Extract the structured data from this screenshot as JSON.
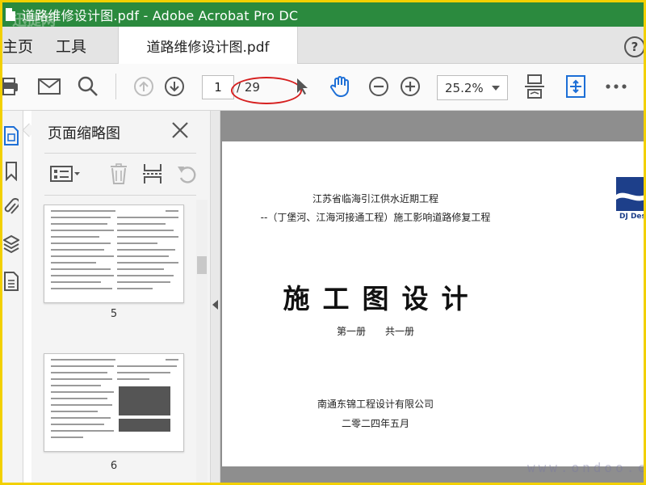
{
  "window": {
    "title": "道路维修设计图.pdf - Adobe Acrobat Pro DC",
    "watermark_top": "迅捷网"
  },
  "tabs": {
    "home": "主页",
    "tools": "工具",
    "document": "道路维修设计图.pdf",
    "help": "?"
  },
  "toolbar": {
    "current_page": "1",
    "total_pages": "/ 29",
    "zoom": "25.2%"
  },
  "panel": {
    "title": "页面缩略图",
    "thumbnails": [
      {
        "label": "5"
      },
      {
        "label": "6"
      }
    ]
  },
  "document": {
    "line1": "江苏省临海引江供水近期工程",
    "line2": "--（丁堡河、江海河接通工程）施工影响道路修复工程",
    "main_title": "施工图设计",
    "volume": "第一册　　共一册",
    "company": "南通东锦工程设计有限公司",
    "date": "二零二四年五月",
    "logo_text": "DJ Desi",
    "watermark_bottom": "www.ondoo.com"
  },
  "colors": {
    "titlebar": "#2b8a3e",
    "frame": "#f2d000",
    "accent_blue": "#1d6fd6",
    "annotation_red": "#d62020"
  }
}
